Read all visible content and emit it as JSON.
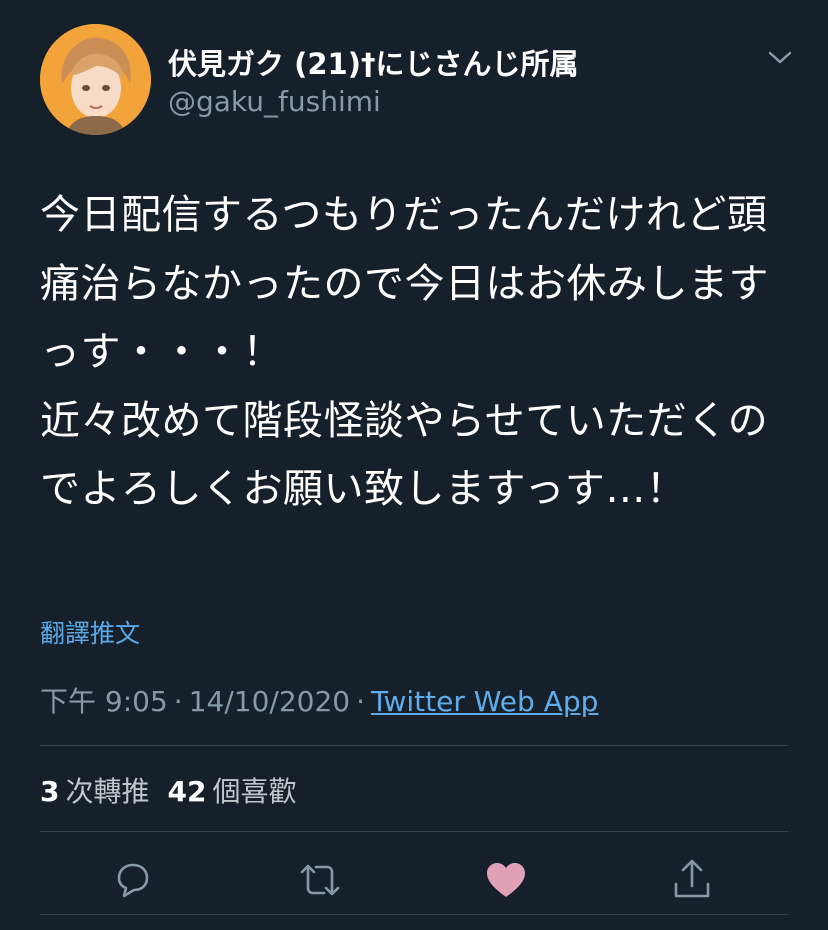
{
  "author": {
    "display_name": "伏見ガク (21)†にじさんじ所属",
    "handle": "@gaku_fushimi",
    "avatar_icon": "avatar-portrait-icon"
  },
  "tweet": {
    "text": "今日配信するつもりだったんだけれど頭痛治らなかったので今日はお休みしますっす・・・！\n近々改めて階段怪談やらせていただくのでよろしくお願い致しますっす…！",
    "translate_label": "翻譯推文",
    "time": "下午 9:05",
    "separator": "·",
    "date": "14/10/2020",
    "source": "Twitter Web App"
  },
  "stats": {
    "retweets_count": "3",
    "retweets_label": "次轉推",
    "likes_count": "42",
    "likes_label": "個喜歡"
  },
  "actions": {
    "reply_icon": "reply-icon",
    "retweet_icon": "retweet-icon",
    "like_icon": "heart-icon",
    "share_icon": "share-icon"
  },
  "colors": {
    "background": "#16202b",
    "accent_link": "#60abe8",
    "secondary_text": "#8899a6",
    "divider": "#38444d",
    "like_active": "#e0a0b6",
    "avatar_bg": "#f2a43a"
  }
}
